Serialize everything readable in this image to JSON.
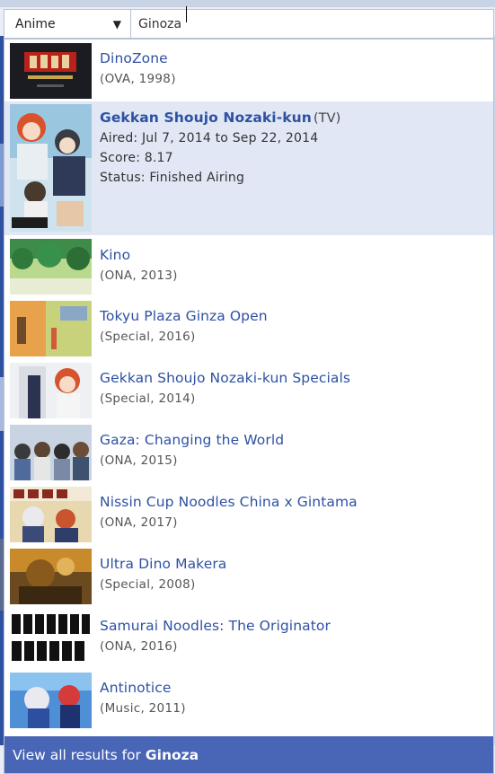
{
  "search": {
    "type_selected": "Anime",
    "query": "Ginoza"
  },
  "results": [
    {
      "title": "DinoZone",
      "meta": "(OVA, 1998)"
    },
    {
      "title": "Gekkan Shoujo Nozaki-kun",
      "media_type": "(TV)",
      "aired": "Aired: Jul 7, 2014 to Sep 22, 2014",
      "score": "Score: 8.17",
      "status": "Status: Finished Airing"
    },
    {
      "title": "Kino",
      "meta": "(ONA, 2013)"
    },
    {
      "title": "Tokyu Plaza Ginza Open",
      "meta": "(Special, 2016)"
    },
    {
      "title": "Gekkan Shoujo Nozaki-kun Specials",
      "meta": "(Special, 2014)"
    },
    {
      "title": "Gaza: Changing the World",
      "meta": "(ONA, 2015)"
    },
    {
      "title": "Nissin Cup Noodles China x Gintama",
      "meta": "(ONA, 2017)"
    },
    {
      "title": "Ultra Dino Makera",
      "meta": "(Special, 2008)"
    },
    {
      "title": "Samurai Noodles: The Originator",
      "meta": "(ONA, 2016)"
    },
    {
      "title": "Antinotice",
      "meta": "(Music, 2011)"
    }
  ],
  "footer": {
    "label": "View all results for",
    "query": "Ginoza"
  },
  "colors": {
    "link": "#2e51a2",
    "highlight": "#e1e7f5",
    "footer": "#4965b5"
  }
}
